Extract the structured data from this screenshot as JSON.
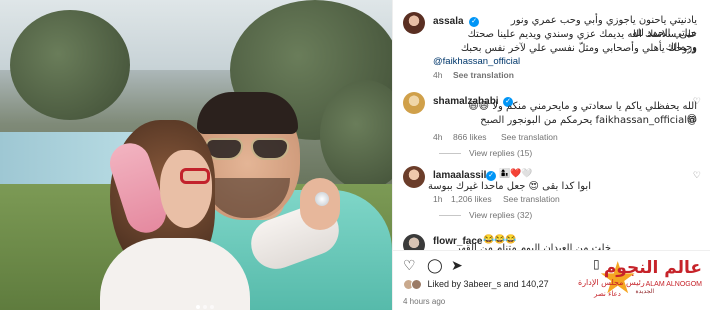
{
  "post": {
    "author": {
      "username": "assala",
      "verified": true
    },
    "caption_lines": [
      "يادنيتي ياحنون ياجوزي وأبي وحب عمري ونور حياتي الحمد لله",
      "على سلامتك الله يديمك عزي وسندي ويديم علينا صحتك وجمالك",
      "وروحك يأهلي وأصحابي ومثلّ نفسي علي لآخر نفس بحبك"
    ],
    "caption_mention": "@faikhassan_official",
    "time": "4h",
    "see_translation": "See translation"
  },
  "comments": [
    {
      "username": "shamalzahabi",
      "verified": true,
      "lines": [
        "الله يحفظلي ياكم يا سعادتي و مايحرمني منكم ولا 😄😄😄",
        "@faikhassan_official يحرمكم من البونجور الصبح"
      ],
      "time": "4h",
      "likes": "866 likes",
      "see_translation": "See translation",
      "view_replies": "View replies (15)"
    },
    {
      "username": "lamaalassil",
      "verified": true,
      "reaction_emojis": "👩‍👦❤️🤍",
      "lines": [
        "ابوا كدا بقى 😍 جعل ماحدا غيرك ببوسة"
      ],
      "time": "1h",
      "likes": "1,206 likes",
      "see_translation": "See translation",
      "view_replies": "View replies (32)"
    },
    {
      "username": "flowr_face",
      "reaction_emojis": "😂😂😂",
      "lines": [
        "خلت من العيدان اليوم متنام من القهر"
      ]
    }
  ],
  "likes_summary": {
    "text": "Liked by 3abeer_s and 140,27"
  },
  "time_ago": "4 hours ago",
  "watermark": {
    "title": "عالم النجوم",
    "subtitle": "ALAM ALNOGOM",
    "small": "الجديدة",
    "sign": "رئيس مجلس الإدارة",
    "sign_name": "دعاء نصر"
  },
  "icons": {
    "like": "heart-icon",
    "comment": "comment-icon",
    "share": "share-icon",
    "save": "bookmark-icon",
    "verified_color": "#0095f6",
    "mention_color": "#00376b"
  }
}
